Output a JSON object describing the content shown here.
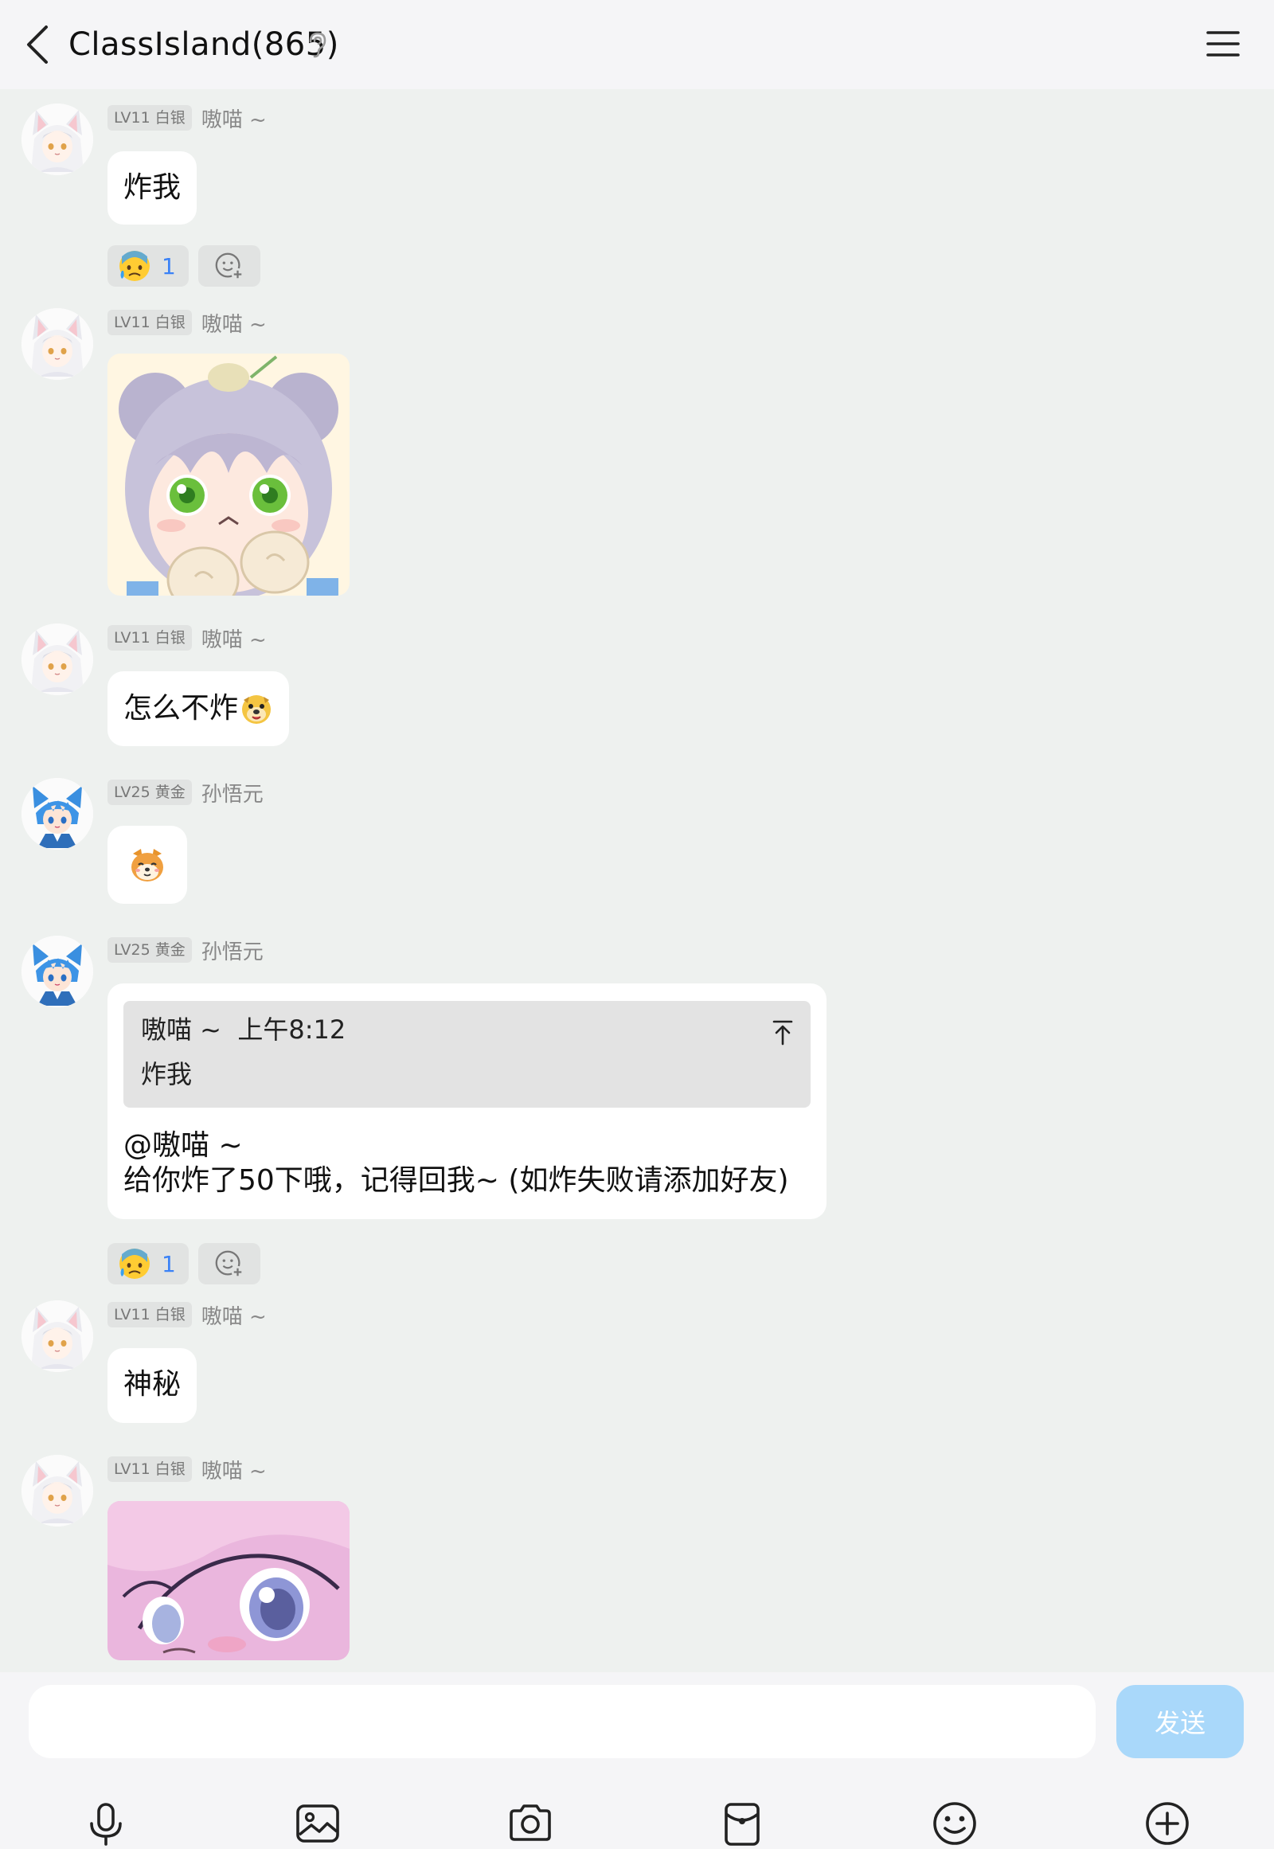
{
  "header": {
    "title": "ClassIsland(865)"
  },
  "messages": [
    {
      "badge": "LV11 白银",
      "nick": "嗷喵 ~",
      "text": "炸我",
      "reaction_count": "1"
    },
    {
      "badge": "LV11 白银",
      "nick": "嗷喵 ~"
    },
    {
      "badge": "LV11 白银",
      "nick": "嗷喵 ~",
      "text": "怎么不炸"
    },
    {
      "badge": "LV25 黄金",
      "nick": "孙悟元"
    },
    {
      "badge": "LV25 黄金",
      "nick": "孙悟元",
      "quote": {
        "author": "嗷喵 ~",
        "time": "上午8:12",
        "text": "炸我"
      },
      "line1": "@嗷喵 ~",
      "line2": "给你炸了50下哦，记得回我~ (如炸失败请添加好友)",
      "reaction_count": "1"
    },
    {
      "badge": "LV11 白银",
      "nick": "嗷喵 ~",
      "text": "神秘"
    },
    {
      "badge": "LV11 白银",
      "nick": "嗷喵 ~"
    }
  ],
  "composer": {
    "send_label": "发送",
    "placeholder": ""
  },
  "toolbar": [
    "mic-icon",
    "image-icon",
    "camera-icon",
    "red-packet-icon",
    "emoji-icon",
    "plus-icon"
  ],
  "colors": {
    "accent": "#3b82f6",
    "send_disabled": "#a9d8fa",
    "background": "#eef1ef"
  }
}
